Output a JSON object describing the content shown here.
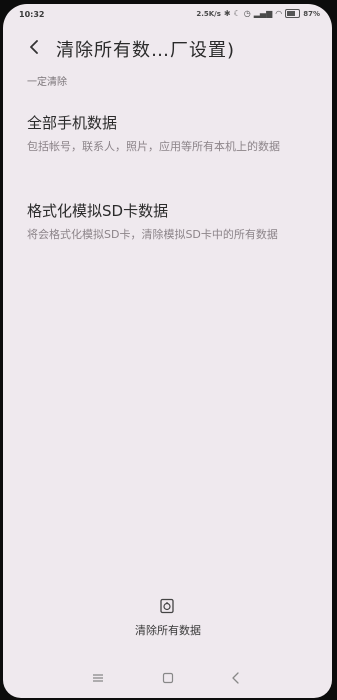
{
  "status_bar": {
    "time": "10:32",
    "network_speed": "2.5K/s",
    "battery": "87%"
  },
  "header": {
    "title": "清除所有数…厂设置)"
  },
  "section": {
    "label": "一定清除"
  },
  "options": [
    {
      "title": "全部手机数据",
      "description": "包括帐号，联系人，照片，应用等所有本机上的数据"
    },
    {
      "title": "格式化模拟SD卡数据",
      "description": "将会格式化模拟SD卡，清除模拟SD卡中的所有数据"
    }
  ],
  "action": {
    "label": "清除所有数据"
  },
  "icons": {
    "back": "chevron-left-icon",
    "clear": "reset-icon",
    "menu": "menu-icon",
    "home": "home-icon",
    "nav_back": "back-icon"
  },
  "colors": {
    "background": "#efe9ee",
    "title_text": "#2b2b2b",
    "secondary_text": "#8c8489"
  }
}
